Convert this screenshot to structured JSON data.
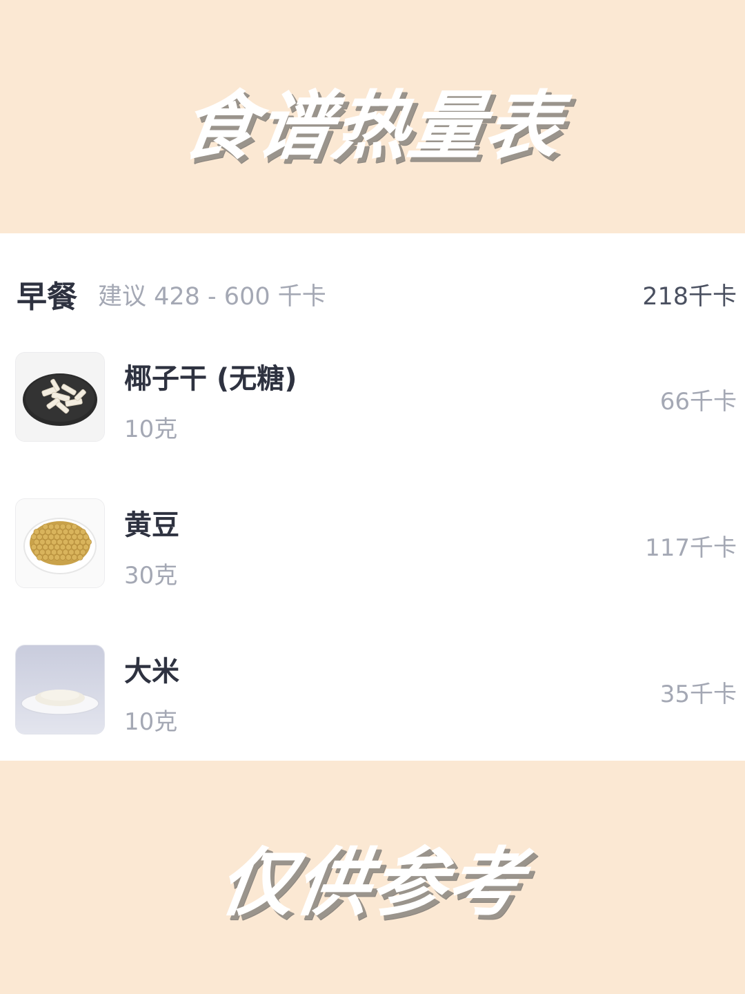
{
  "header": {
    "title": "食谱热量表"
  },
  "footer": {
    "title": "仅供参考"
  },
  "meal": {
    "name": "早餐",
    "suggestion": "建议 428 - 600 千卡",
    "total": "218千卡",
    "items": [
      {
        "name": "椰子干 (无糖)",
        "amount": "10克",
        "kcal": "66千卡",
        "icon": "dried-coconut-plate-icon"
      },
      {
        "name": "黄豆",
        "amount": "30克",
        "kcal": "117千卡",
        "icon": "soybeans-plate-icon"
      },
      {
        "name": "大米",
        "amount": "10克",
        "kcal": "35千卡",
        "icon": "rice-plate-icon"
      }
    ]
  },
  "colors": {
    "banner_bg": "#fbe8d3",
    "panel_bg": "#ffffff",
    "text_primary": "#2e3240",
    "text_secondary": "#a4a8b4"
  }
}
